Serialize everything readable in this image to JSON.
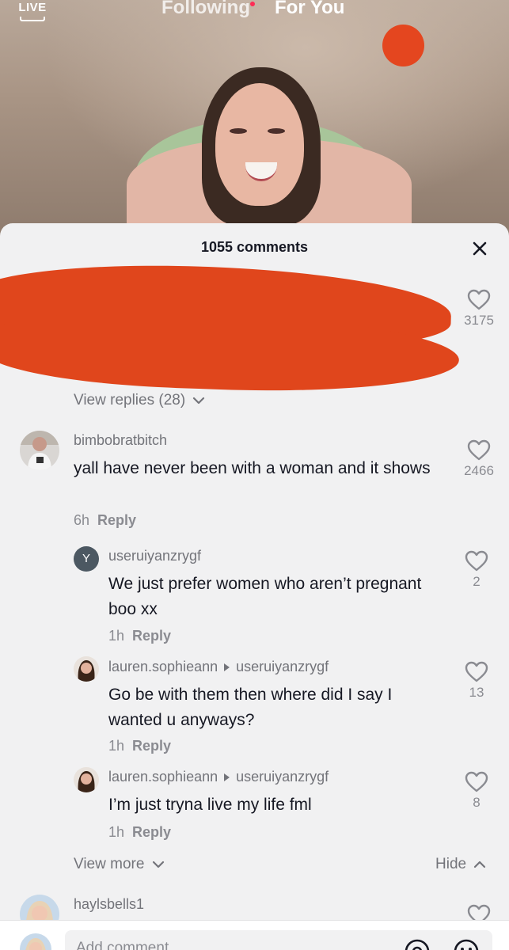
{
  "top_nav": {
    "live_label": "LIVE",
    "following_label": "Following",
    "for_you_label": "For You"
  },
  "comments_sheet": {
    "title": "1055 comments",
    "first_comment": {
      "likes": "3175",
      "view_replies": "View replies (28)"
    },
    "comments": [
      {
        "username": "bimbobratbitch",
        "text": "yall have never been with a woman and it shows",
        "time": "6h",
        "reply_label": "Reply",
        "likes": "2466"
      }
    ],
    "replies": [
      {
        "avatar_letter": "Y",
        "username": "useruiyanzrygf",
        "text": "We just prefer women who aren’t pregnant boo xx",
        "time": "1h",
        "reply_label": "Reply",
        "likes": "2"
      },
      {
        "username": "lauren.sophieann",
        "reply_to": "useruiyanzrygf",
        "text": "Go be with them then where did I say I wanted u anyways?",
        "time": "1h",
        "reply_label": "Reply",
        "likes": "13"
      },
      {
        "username": "lauren.sophieann",
        "reply_to": "useruiyanzrygf",
        "text": "I’m just tryna live my life fml",
        "time": "1h",
        "reply_label": "Reply",
        "likes": "8"
      }
    ],
    "view_more": "View more",
    "hide": "Hide",
    "next_comment": {
      "username": "haylsbells1"
    },
    "input_placeholder": "Add comment..."
  },
  "colors": {
    "redaction": "#e0461c",
    "muted_text": "#73747a",
    "sheet_bg": "#f1f1f2"
  }
}
